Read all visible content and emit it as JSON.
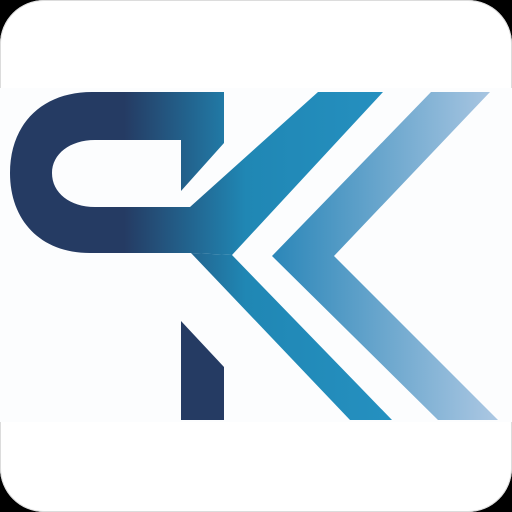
{
  "app_icon": {
    "icon_name": "pk-monogram-logo-icon",
    "colors": {
      "tile_background": "#ffffff",
      "dark_navy": "#253b63",
      "mid_blue": "#2087b4",
      "light_blue": "#a9c5e1"
    }
  }
}
